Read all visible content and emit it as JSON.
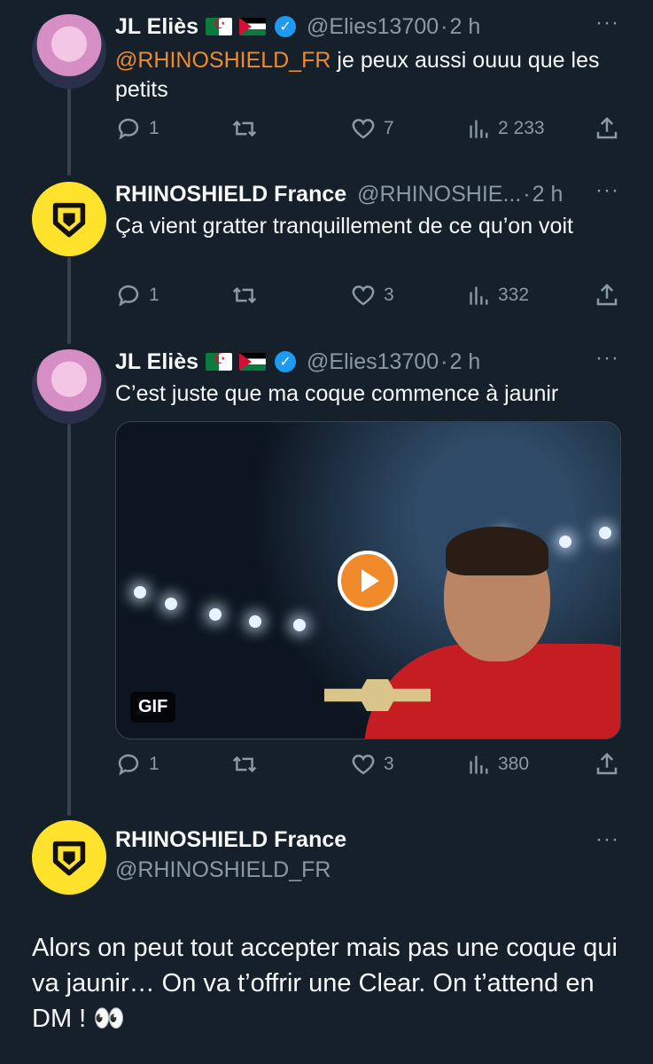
{
  "tweets": [
    {
      "name": "JL Eliès",
      "handle": "@Elies13700",
      "time": "2 h",
      "mention": "@RHINOSHIELD_FR",
      "text": " je peux aussi ouuu que les petits",
      "replies": "1",
      "retweets": "",
      "likes": "7",
      "views": "2 233"
    },
    {
      "name": "RHINOSHIELD France",
      "handle": "@RHINOSHIE...",
      "time": "2 h",
      "text": "Ça vient gratter tranquillement de ce qu’on voit",
      "replies": "1",
      "retweets": "",
      "likes": "3",
      "views": "332"
    },
    {
      "name": "JL Eliès",
      "handle": "@Elies13700",
      "time": "2 h",
      "text": "C’est juste que ma coque commence à jaunir",
      "media_badge": "GIF",
      "replies": "1",
      "retweets": "",
      "likes": "3",
      "views": "380"
    }
  ],
  "main_tweet": {
    "name": "RHINOSHIELD France",
    "handle": "@RHINOSHIELD_FR",
    "text": "Alors on peut tout accepter mais pas une coque qui va jaunir… On va t’offrir une Clear. On t’attend en DM ! 👀"
  },
  "separator": "·",
  "more_label": "···",
  "verified_glyph": "✓",
  "icons": {
    "reply": "reply-icon",
    "retweet": "retweet-icon",
    "like": "heart-icon",
    "views": "views-icon",
    "share": "share-icon",
    "more": "more-icon",
    "verified": "verified-badge-icon",
    "play": "play-icon"
  },
  "colors": {
    "background": "#15202b",
    "text": "#f7f9f9",
    "muted": "#8b98a5",
    "mention": "#f08a2b",
    "brand_yellow": "#ffe22b",
    "verified": "#1d9bf0",
    "thread_line": "#38444d"
  }
}
